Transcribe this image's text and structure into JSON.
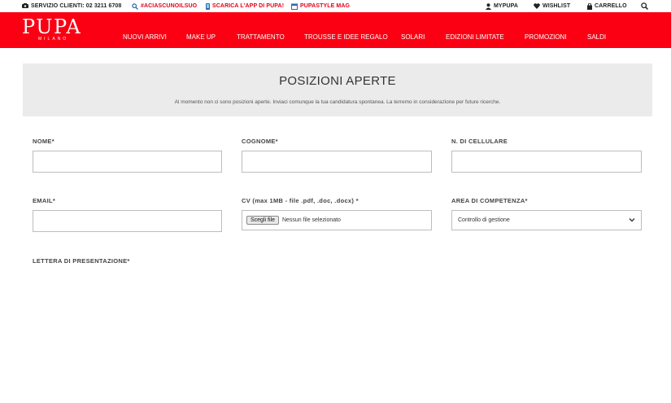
{
  "topbar": {
    "customer_service": "SERVIZIO CLIENTI: 02 3211 6708",
    "hashtag": "#ACIASCUNOILSUO",
    "app": "SCARICA L'APP DI PUPA!",
    "mag": "PUPASTYLE MAG",
    "mypupa": "MYPUPA",
    "wishlist": "WISHLIST",
    "cart": "CARRELLO"
  },
  "brand": {
    "logo": "PUPA",
    "sub": "MILANO"
  },
  "nav": {
    "items": [
      "NUOVI ARRIVI",
      "MAKE UP",
      "TRATTAMENTO",
      "TROUSSE E IDEE REGALO",
      "SOLARI",
      "EDIZIONI LIMITATE",
      "PROMOZIONI",
      "SALDI"
    ]
  },
  "hero": {
    "title": "POSIZIONI APERTE",
    "text": "Al momento non ci sono posizioni aperte. Inviaci comunque la tua candidatura spontanea. La terremo in considerazione per future ricerche."
  },
  "form": {
    "nome_label": "NOME*",
    "cognome_label": "COGNOME*",
    "cellulare_label": "N. DI CELLULARE",
    "email_label": "EMAIL*",
    "cv_label": "CV (max 1MB - file .pdf, .doc, .docx) *",
    "cv_button": "Scegli file",
    "cv_status": "Nessun file selezionato",
    "area_label": "AREA DI COMPETENZA*",
    "area_value": "Controllo di gestione",
    "lettera_label": "LETTERA DI PRESENTAZIONE*"
  },
  "colors": {
    "brand_red": "#fb0013",
    "link_red": "#e3021c",
    "hero_bg": "#ebebeb"
  }
}
